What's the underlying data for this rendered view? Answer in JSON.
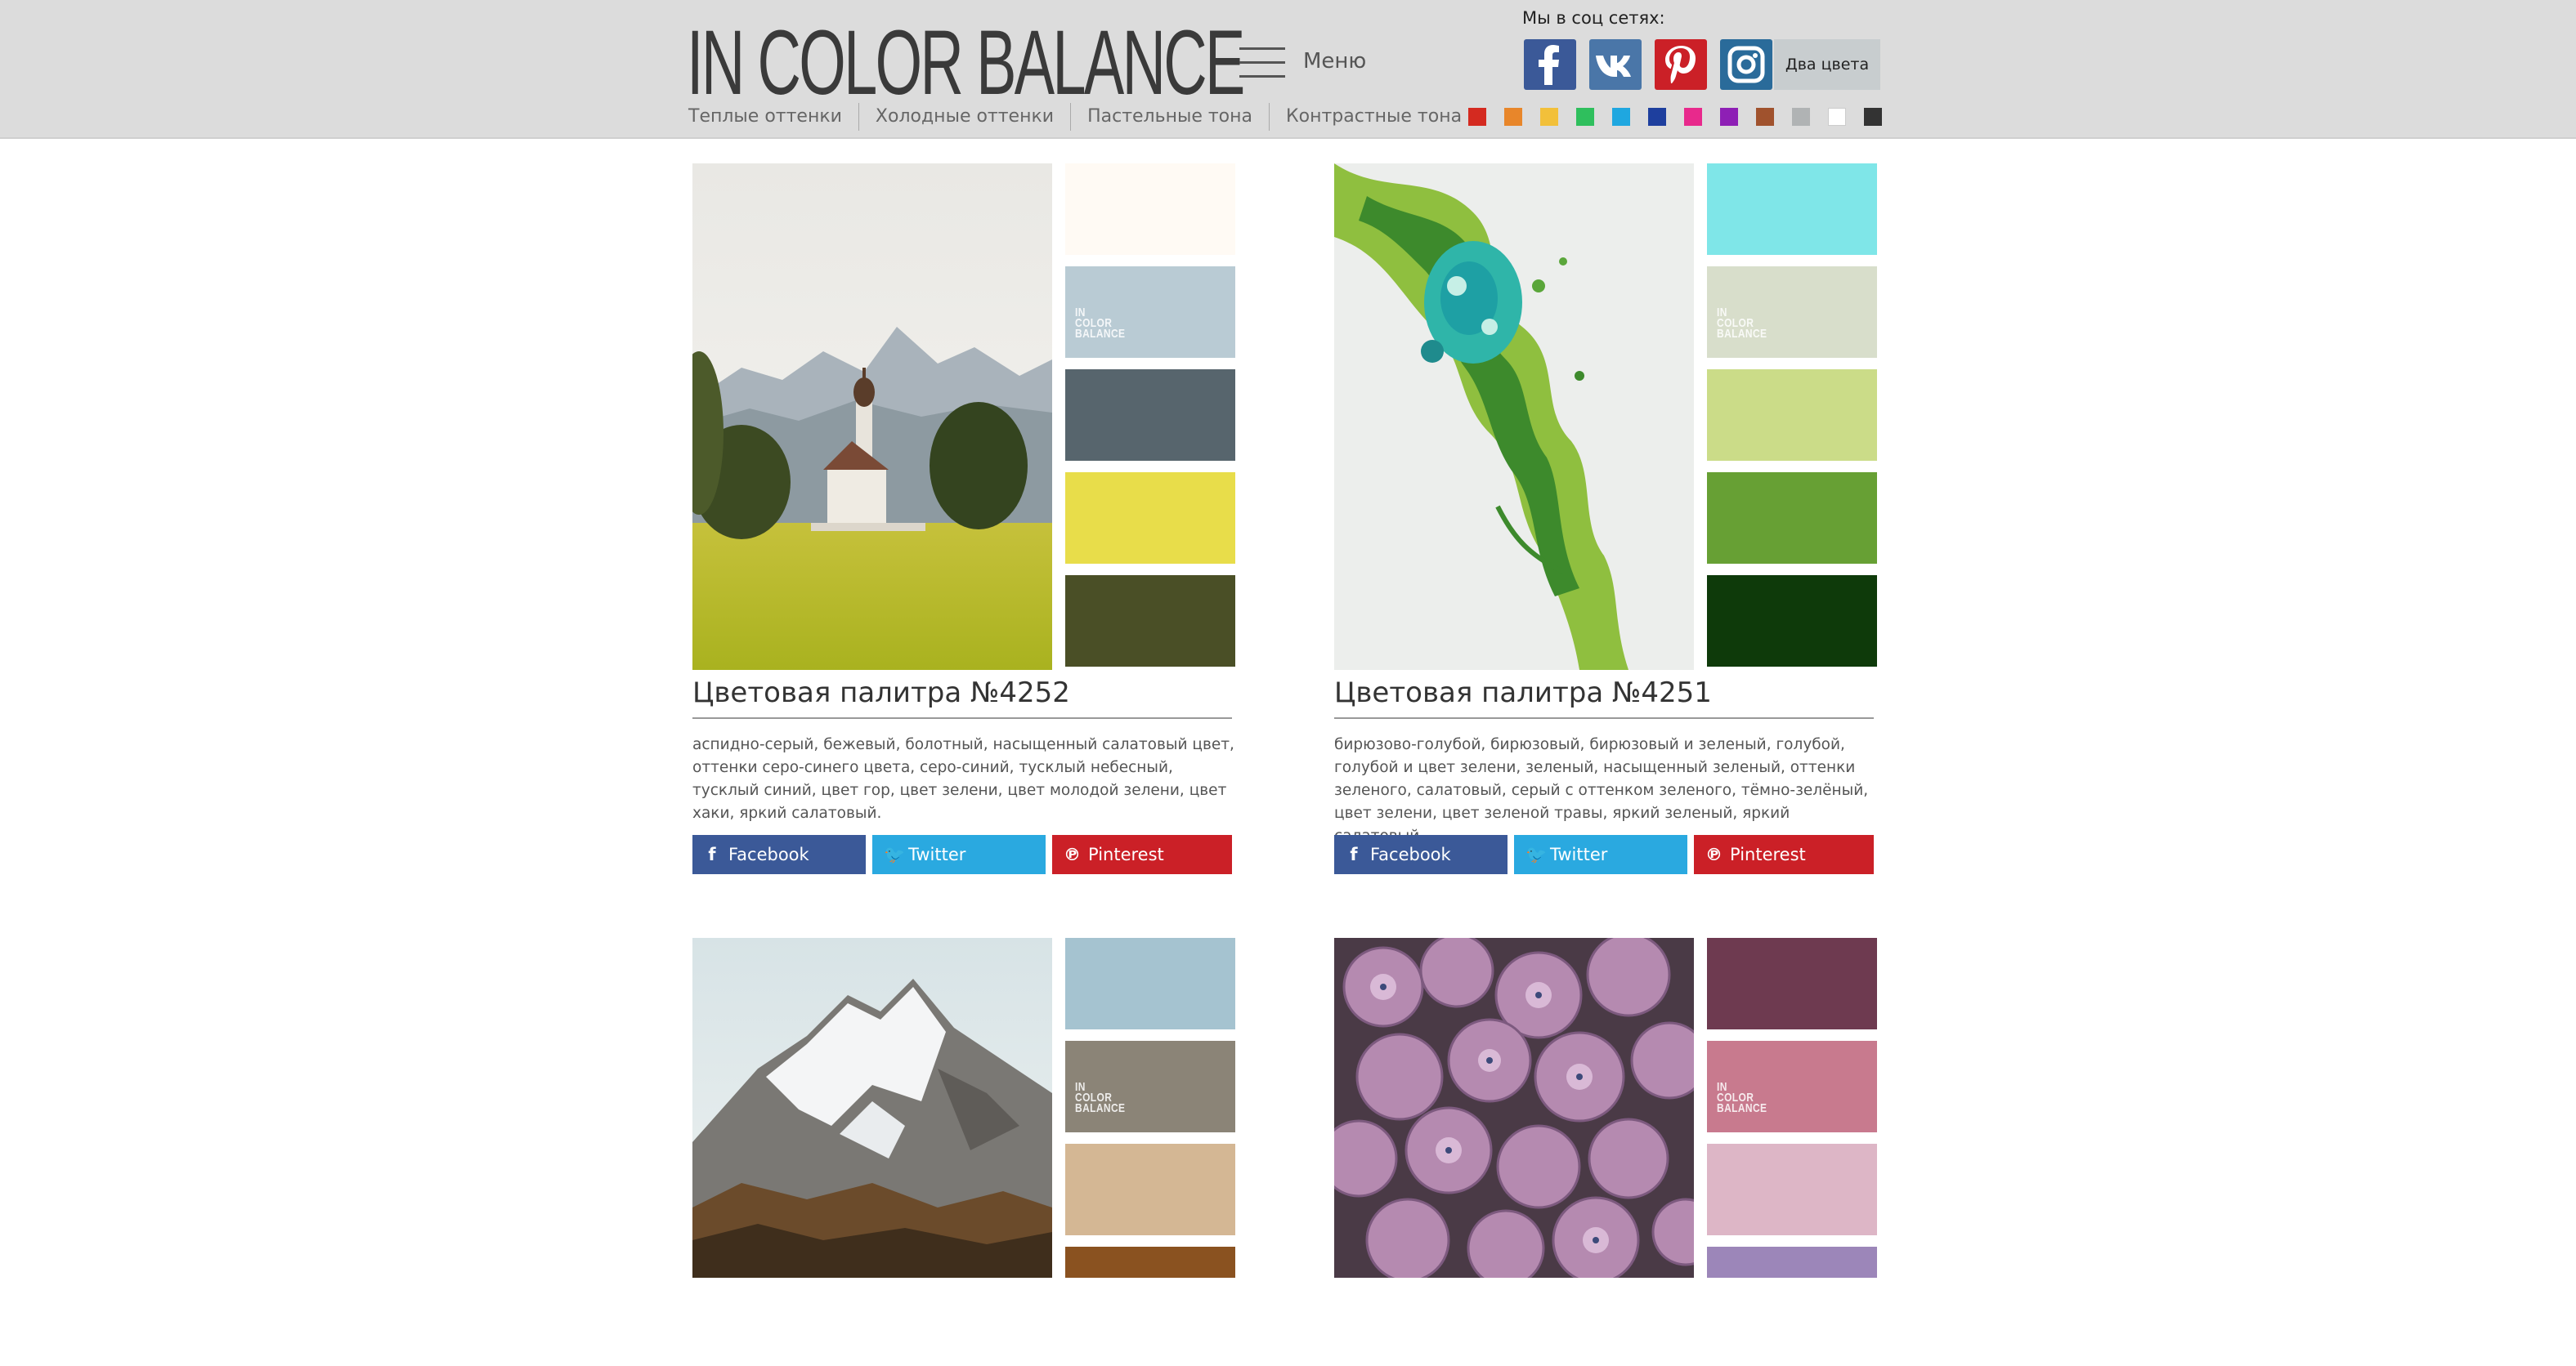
{
  "header": {
    "logo": "IN COLOR BALANCE",
    "menu_label": "Меню",
    "social_caption": "Мы в соц сетях:",
    "social": [
      {
        "name": "facebook",
        "color": "#3b5998"
      },
      {
        "name": "vk",
        "color": "#4a76a8"
      },
      {
        "name": "pinterest",
        "color": "#cb2027"
      },
      {
        "name": "instagram",
        "color": "#2a6b9a"
      }
    ],
    "two_colors": "Два цвета",
    "categories": [
      "Теплые оттенки",
      "Холодные оттенки",
      "Пастельные тона",
      "Контрастные тона"
    ],
    "color_filters": [
      "#d42a20",
      "#e8862a",
      "#f2c03a",
      "#2fbf5d",
      "#1fa7e0",
      "#1e3f9e",
      "#e8298c",
      "#8e1fb5",
      "#a0522d",
      "#b0b3b4",
      "#ffffff",
      "#333333"
    ]
  },
  "watermark": [
    "IN",
    "COLOR",
    "BALANCE"
  ],
  "cards": [
    {
      "title": "Цветовая палитра №4252",
      "description": "аспидно-серый, бежевый, болотный, насыщенный салатовый цвет, оттенки серо-синего цвета, серо-синий, тусклый небесный, тусклый синий, цвет гор, цвет зелени, цвет молодой зелени, цвет хаки, яркий салатовый.",
      "colors": [
        "#fffaf4",
        "#b9cbd4",
        "#57656d",
        "#e8dd4a",
        "#4a4f26"
      ],
      "photo": "church-landscape"
    },
    {
      "title": "Цветовая палитра №4251",
      "description": "бирюзово-голубой, бирюзовый, бирюзовый и зеленый, голубой, голубой и цвет зелени, зеленый, насыщенный зеленый, оттенки зеленого, салатовый, серый с оттенком зеленого, тёмно-зелёный, цвет зелени, цвет зеленой травы, яркий зеленый, яркий салатовый.",
      "colors": [
        "#7fe6e8",
        "#d8decb",
        "#cbdc88",
        "#67a034",
        "#0e3a0a"
      ],
      "photo": "green-fluid-art"
    },
    {
      "title": "",
      "description": "",
      "colors": [
        "#a5c3d0",
        "#8b8477",
        "#d4b794",
        "#8a5220"
      ],
      "photo": "snowy-mountain"
    },
    {
      "title": "",
      "description": "",
      "colors": [
        "#6e3a50",
        "#c87a8e",
        "#ddb6c6",
        "#9c86b9"
      ],
      "photo": "hydrangea"
    }
  ],
  "share": {
    "facebook": "Facebook",
    "twitter": "Twitter",
    "pinterest": "Pinterest",
    "facebook_color": "#3b5998",
    "twitter_color": "#2aa9e0",
    "pinterest_color": "#cb2027"
  }
}
